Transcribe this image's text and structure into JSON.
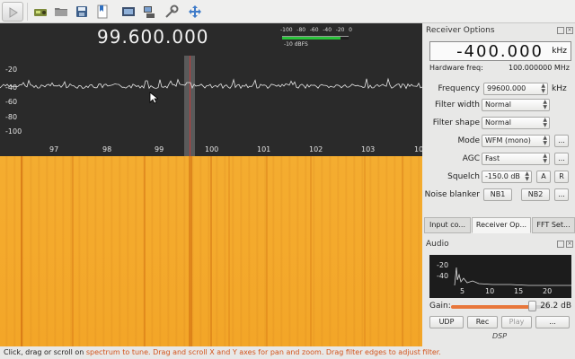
{
  "toolbar": {
    "icons": [
      "play-icon",
      "radio-device-icon",
      "open-folder-icon",
      "save-icon",
      "bookmark-icon",
      "remote-control-icon",
      "network-icon",
      "settings-icon",
      "fullscreen-icon"
    ]
  },
  "spectrum": {
    "frequency_display": "99.600.000",
    "y_labels": [
      "-20",
      "-40",
      "-60",
      "-80",
      "-100"
    ],
    "x_labels": [
      "97",
      "98",
      "99",
      "100",
      "101",
      "102",
      "103",
      "10"
    ],
    "dbfs_scale": [
      "-100",
      "-80",
      "-60",
      "-40",
      "-20",
      "0"
    ],
    "dbfs_label": "-10 dBFS",
    "dbfs_level_percent": 88
  },
  "status": {
    "part1": "Click, drag or scroll on ",
    "part2": "spectrum to tune. Drag and scroll X and Y axes for pan and zoom. Drag filter edges to adjust filter."
  },
  "receiver": {
    "title": "Receiver Options",
    "offset_value": "-400.000",
    "offset_unit": "kHz",
    "hardware_freq_label": "Hardware freq:",
    "hardware_freq_value": "100.000000 MHz",
    "frequency_label": "Frequency",
    "frequency_value": "99600.000",
    "frequency_unit": "kHz",
    "filter_width_label": "Filter width",
    "filter_width_value": "Normal",
    "filter_shape_label": "Filter shape",
    "filter_shape_value": "Normal",
    "mode_label": "Mode",
    "mode_value": "WFM (mono)",
    "agc_label": "AGC",
    "agc_value": "Fast",
    "squelch_label": "Squelch",
    "squelch_value": "-150.0 dB",
    "squelch_a": "A",
    "squelch_r": "R",
    "noise_blanker_label": "Noise blanker",
    "nb1": "NB1",
    "nb2": "NB2",
    "more": "..."
  },
  "tabs": [
    "Input co...",
    "Receiver Op...",
    "FFT Set..."
  ],
  "audio": {
    "title": "Audio",
    "y_labels": [
      "-20",
      "-40"
    ],
    "x_labels": [
      "5",
      "10",
      "15",
      "20"
    ],
    "gain_label": "Gain:",
    "gain_value": "26.2 dB",
    "gain_level_percent": 82,
    "udp": "UDP",
    "rec": "Rec",
    "play": "Play",
    "more": "...",
    "dsp": "DSP"
  }
}
